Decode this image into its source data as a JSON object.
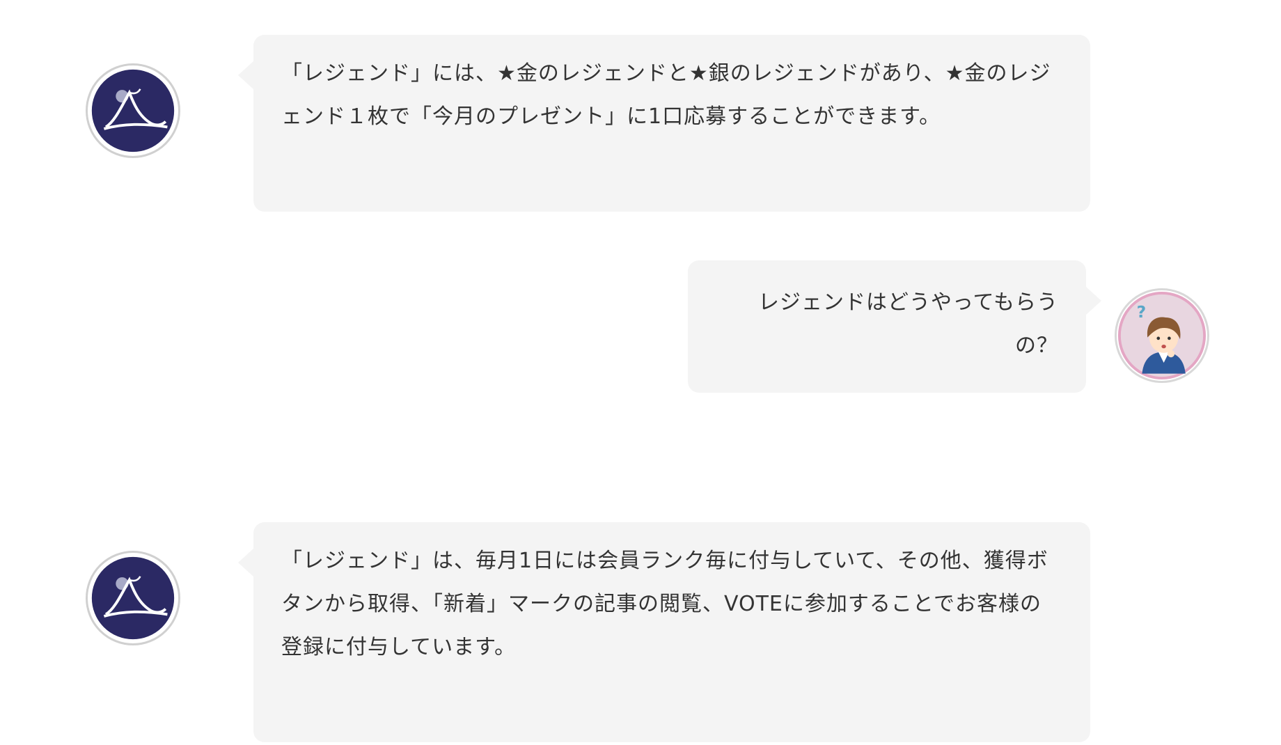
{
  "messages": [
    {
      "speaker": "brand",
      "text": "「レジェンド」には、★金のレジェンドと★銀のレジェンドがあり、★金のレジェンド１枚で「今月のプレゼント」に1口応募することができます。"
    },
    {
      "speaker": "user",
      "text": "レジェンドはどうやってもらうの？"
    },
    {
      "speaker": "brand",
      "text": "「レジェンド」は、毎月1日には会員ランク毎に付与していて、その他、獲得ボタンから取得、「新着」マークの記事の閲覧、VOTEに参加することでお客様の登録に付与しています。"
    }
  ],
  "avatars": {
    "brand": {
      "icon": "brand-logo-icon",
      "color": "#2b2964"
    },
    "user": {
      "icon": "confused-woman-icon",
      "color": "#e8d6e0",
      "ring": "#e4a6c4"
    }
  },
  "colors": {
    "bubble": "#f4f4f4",
    "text": "#333333"
  }
}
